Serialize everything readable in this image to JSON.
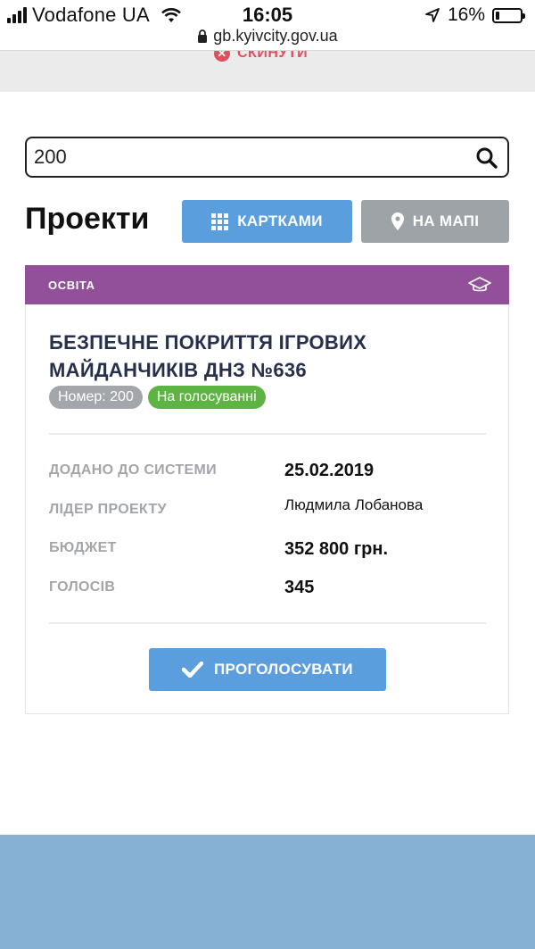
{
  "status_bar": {
    "carrier": "Vodafone UA",
    "time": "16:05",
    "battery": "16%",
    "battery_level": 0.16
  },
  "browser": {
    "url": "gb.kyivcity.gov.ua"
  },
  "filters": {
    "reset_label": "СКИНУТИ"
  },
  "search": {
    "value": "200"
  },
  "projects": {
    "title": "Проекти",
    "view_cards_label": "КАРТКАМИ",
    "view_map_label": "НА МАПІ"
  },
  "project_card": {
    "category": "ОСВІТА",
    "title": "БЕЗПЕЧНЕ ПОКРИТТЯ ІГРОВИХ МАЙДАНЧИКІВ ДНЗ №636",
    "number_badge": "Номер: 200",
    "status_badge": "На голосуванні",
    "added_label": "ДОДАНО ДО СИСТЕМИ",
    "added_value": "25.02.2019",
    "leader_label": "ЛІДЕР ПРОЕКТУ",
    "leader_value": "Людмила Лобанова",
    "budget_label": "БЮДЖЕТ",
    "budget_value": "352 800 грн.",
    "votes_label": "ГОЛОСІВ",
    "votes_value": "345",
    "vote_button": "ПРОГОЛОСУВАТИ"
  },
  "colors": {
    "primary_button": "#5a9ede",
    "map_button": "#9ea3a8",
    "category_header": "#93509a",
    "status_badge": "#5eb442",
    "number_badge": "#a3a6aa",
    "reset_red": "#e04f5f",
    "footer": "#86b0d4"
  },
  "icons": {
    "search": "search-icon",
    "grid": "grid-icon",
    "map_pin": "map-pin-icon",
    "category": "graduation-cap-icon",
    "vote": "checkmark-icon",
    "reset": "close-circle-icon"
  }
}
